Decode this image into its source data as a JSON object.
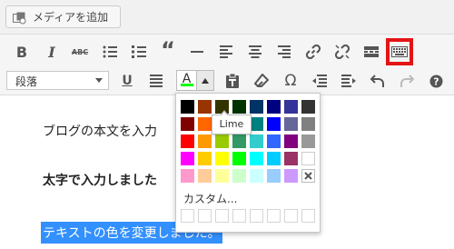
{
  "media_button": {
    "label": "メディアを追加"
  },
  "toolbar": {
    "row1_icons": [
      "bold-icon",
      "italic-icon",
      "strikethrough-icon",
      "bullet-list-icon",
      "numbered-list-icon",
      "blockquote-icon",
      "horizontal-rule-icon",
      "align-left-icon",
      "align-center-icon",
      "align-right-icon",
      "link-icon",
      "unlink-icon",
      "read-more-icon",
      "toolbar-toggle-icon"
    ],
    "row2_icons": [
      "underline-icon",
      "justify-icon",
      "text-color-icon",
      "paste-text-icon",
      "clear-formatting-icon",
      "special-character-icon",
      "outdent-icon",
      "indent-icon",
      "undo-icon",
      "redo-icon",
      "help-icon"
    ],
    "format_select": {
      "value": "段落"
    },
    "text_color_letter": "A",
    "current_text_color": "#00ff00"
  },
  "content": {
    "line1": "ブログの本文を入力",
    "line2": "太字で入力しました",
    "line3": "テキストの色を変更しました。"
  },
  "color_picker": {
    "swatches": [
      [
        "#000000",
        "#993300",
        "#333300",
        "#003300",
        "#003366",
        "#000080",
        "#333399",
        "#333333"
      ],
      [
        "#800000",
        "#ff6600",
        "#808000",
        "#008000",
        "#008080",
        "#0000ff",
        "#666699",
        "#808080"
      ],
      [
        "#ff0000",
        "#ff9900",
        "#99cc00",
        "#339966",
        "#33cccc",
        "#3366ff",
        "#800080",
        "#999999"
      ],
      [
        "#ff00ff",
        "#ffcc00",
        "#ffff00",
        "#00ff00",
        "#00ffff",
        "#00ccff",
        "#993366",
        "#ffffff"
      ],
      [
        "#ff99cc",
        "#ffcc99",
        "#ffff99",
        "#ccffcc",
        "#ccffff",
        "#99ccff",
        "#cc99ff",
        "remove"
      ]
    ],
    "custom_label": "カスタム...",
    "tooltip": "Lime",
    "custom_slots": 8
  }
}
